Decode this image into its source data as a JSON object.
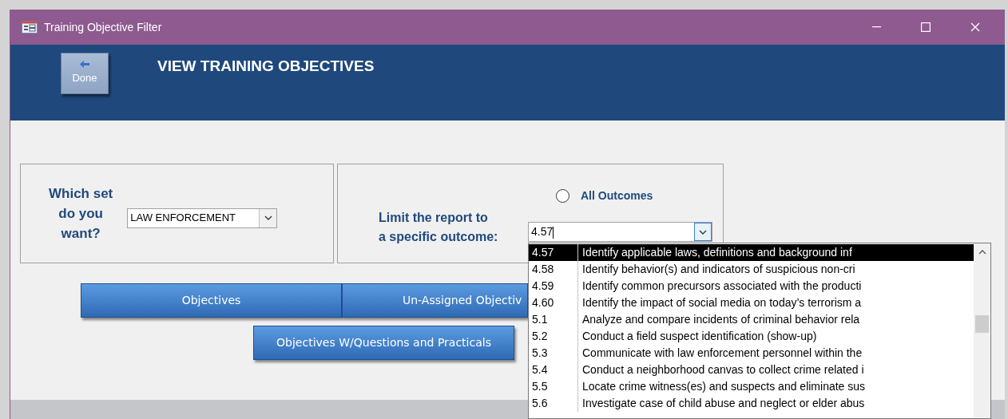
{
  "window": {
    "title": "Training Objective Filter"
  },
  "header": {
    "done_button": "Done",
    "title": "VIEW TRAINING OBJECTIVES"
  },
  "set_selector": {
    "label_lines": [
      "Which set",
      "do you",
      "want?"
    ],
    "value": "LAW ENFORCEMENT"
  },
  "outcome_selector": {
    "all_outcomes": {
      "label": "All Outcomes",
      "checked": false
    },
    "label_lines": [
      "Limit the report to",
      "a specific outcome:"
    ],
    "value": "4.57"
  },
  "buttons": [
    "Objectives",
    "Un-Assigned Objectiv",
    "Objectives W/Questions and Practicals"
  ],
  "outcome_list": [
    {
      "code": "4.57",
      "text": "Identify applicable laws, definitions and background inf",
      "selected": true
    },
    {
      "code": "4.58",
      "text": "Identify behavior(s) and indicators of suspicious non-cri",
      "selected": false
    },
    {
      "code": "4.59",
      "text": "Identify common precursors associated with the producti",
      "selected": false
    },
    {
      "code": "4.60",
      "text": "Identify the impact of social media on today’s terrorism a",
      "selected": false
    },
    {
      "code": "5.1",
      "text": "Analyze and compare incidents of criminal behavior rela",
      "selected": false
    },
    {
      "code": "5.2",
      "text": "Conduct a field suspect identification (show-up)",
      "selected": false
    },
    {
      "code": "5.3",
      "text": "Communicate with law enforcement personnel within the",
      "selected": false
    },
    {
      "code": "5.4",
      "text": "Conduct a neighborhood canvas to collect crime related i",
      "selected": false
    },
    {
      "code": "5.5",
      "text": "Locate crime witness(es) and suspects and eliminate sus",
      "selected": false
    },
    {
      "code": "5.6",
      "text": "Investigate case of child abuse and neglect or elder abus",
      "selected": false
    }
  ]
}
